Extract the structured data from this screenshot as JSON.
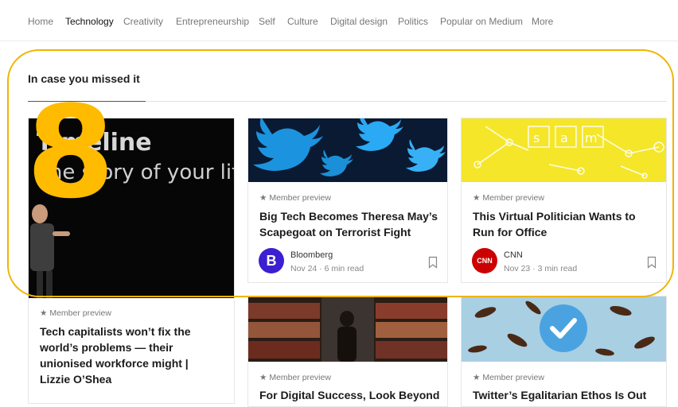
{
  "nav": {
    "items": [
      {
        "label": "Home",
        "active": false
      },
      {
        "label": "Technology",
        "active": true
      },
      {
        "label": "Creativity",
        "active": false
      },
      {
        "label": "Entrepreneurship",
        "active": false
      },
      {
        "label": "Self",
        "active": false
      },
      {
        "label": "Culture",
        "active": false
      },
      {
        "label": "Digital design",
        "active": false
      },
      {
        "label": "Politics",
        "active": false
      },
      {
        "label": "Popular on Medium",
        "active": false
      },
      {
        "label": "More",
        "active": false
      }
    ]
  },
  "section": {
    "title": "In case you missed it"
  },
  "overlay": {
    "number": "8",
    "color": "#f0b400"
  },
  "cards": [
    {
      "preview": "★ Member preview",
      "title": "Tech capitalists won’t fix the world’s problems — their unionised workforce might | Lizzie O’Shea",
      "image_text": "Timeline The story of your life"
    },
    {
      "preview": "★ Member preview",
      "title": "Big Tech Becomes Theresa May’s Scapegoat on Terrorist Fight",
      "publisher": "Bloomberg",
      "meta": "Nov 24 · 6 min read",
      "logo_letter": "B",
      "logo_color": "#3b1fd1"
    },
    {
      "preview": "★ Member preview",
      "title": "This Virtual Politician Wants to Run for Office",
      "publisher": "CNN",
      "meta": "Nov 23 · 3 min read",
      "logo_letter": "CNN",
      "logo_color": "#cc0000",
      "image_text": "s a m"
    },
    {
      "preview": "★ Member preview",
      "title": "For Digital Success, Look Beyond"
    },
    {
      "preview": "★ Member preview",
      "title": "Twitter’s Egalitarian Ethos Is Out"
    }
  ]
}
